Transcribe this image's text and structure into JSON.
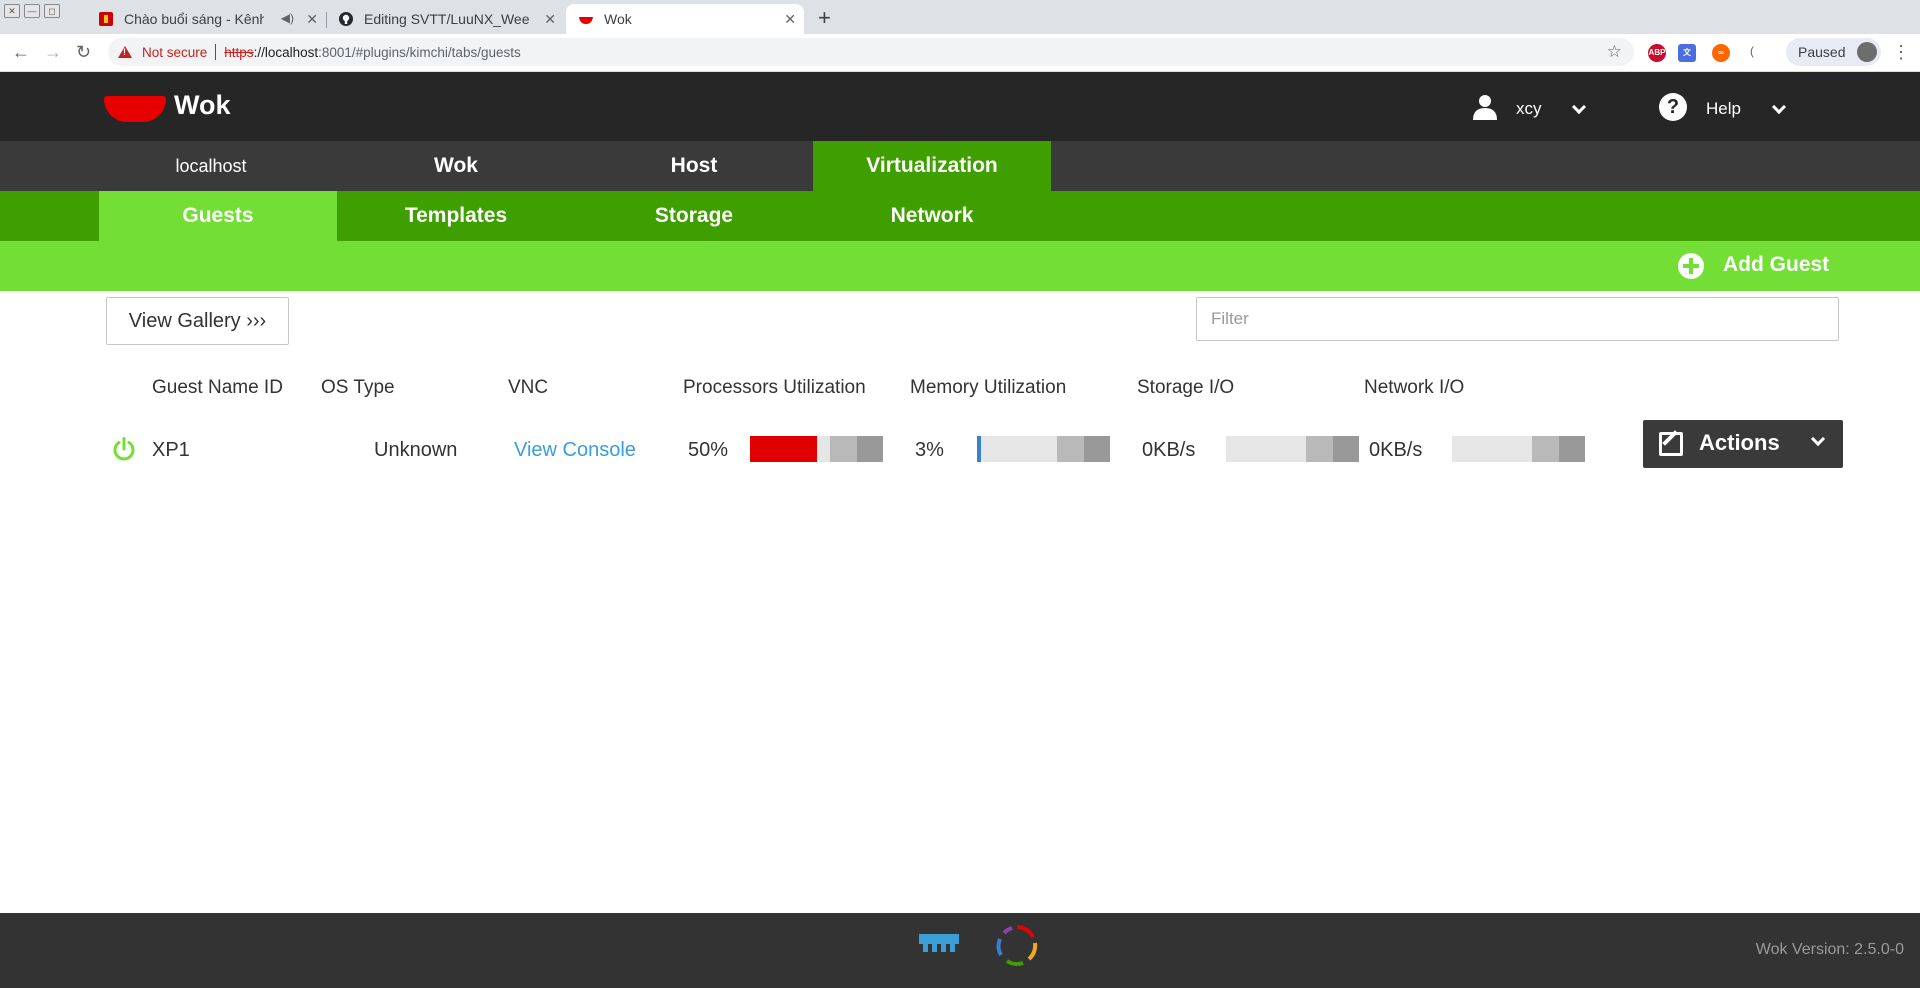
{
  "browser": {
    "window_buttons": [
      "✕",
      "—",
      "◻"
    ],
    "tabs": [
      {
        "title": "Chào buổi sáng - Kênh",
        "favicon_color": "#cc0000"
      },
      {
        "title": "Editing SVTT/LuuNX_Wee",
        "favicon_color": "#24292e"
      },
      {
        "title": "Wok",
        "favicon_color": "#e60000"
      }
    ],
    "tab_close": "✕",
    "new_tab": "+",
    "nav": {
      "back": "←",
      "forward": "→",
      "reload": "↻"
    },
    "security_label": "Not secure",
    "url_scheme": "https",
    "url_host": "://localhost",
    "url_rest": ":8001/#plugins/kimchi/tabs/guests",
    "star": "☆",
    "extensions": [
      {
        "label": "ABP",
        "color": "#c70d2c"
      },
      {
        "label": "文",
        "color": "#4a6ee0"
      },
      {
        "label": "∞",
        "color": "#ff6600"
      }
    ],
    "profile_label": "Paused",
    "menu": "⋮"
  },
  "header": {
    "app_name": "Wok",
    "user": "xcy",
    "help": "Help",
    "help_icon": "?"
  },
  "topnav": {
    "items": [
      {
        "label": "localhost"
      },
      {
        "label": "Wok"
      },
      {
        "label": "Host"
      },
      {
        "label": "Virtualization"
      }
    ],
    "active": "Virtualization"
  },
  "subnav": {
    "items": [
      {
        "label": "Guests"
      },
      {
        "label": "Templates"
      },
      {
        "label": "Storage"
      },
      {
        "label": "Network"
      }
    ],
    "active": "Guests"
  },
  "actionbar": {
    "add_guest": "Add Guest"
  },
  "toolbar": {
    "view_gallery": "View Gallery ›››",
    "filter_placeholder": "Filter"
  },
  "table": {
    "columns": [
      "Guest Name ID",
      "OS Type",
      "VNC",
      "Processors Utilization",
      "Memory Utilization",
      "Storage I/O",
      "Network I/O"
    ],
    "rows": [
      {
        "status": "running",
        "name": "XP1",
        "os_type": "Unknown",
        "vnc": "View Console",
        "cpu": "50%",
        "cpu_fraction": 0.5,
        "memory": "3%",
        "memory_fraction": 0.03,
        "storage_io": "0KB/s",
        "network_io": "0KB/s",
        "actions_label": "Actions"
      }
    ]
  },
  "colors": {
    "header_bg": "#262626",
    "topnav_bg": "#3a3a3a",
    "green_dark": "#3f9e00",
    "green_light": "#73de35",
    "cpu_bar": "#e00000",
    "memory_bar": "#3a7fd0",
    "power_icon": "#73de35",
    "link": "#3a9fd6"
  },
  "footer": {
    "version": "Wok Version: 2.5.0-0"
  }
}
